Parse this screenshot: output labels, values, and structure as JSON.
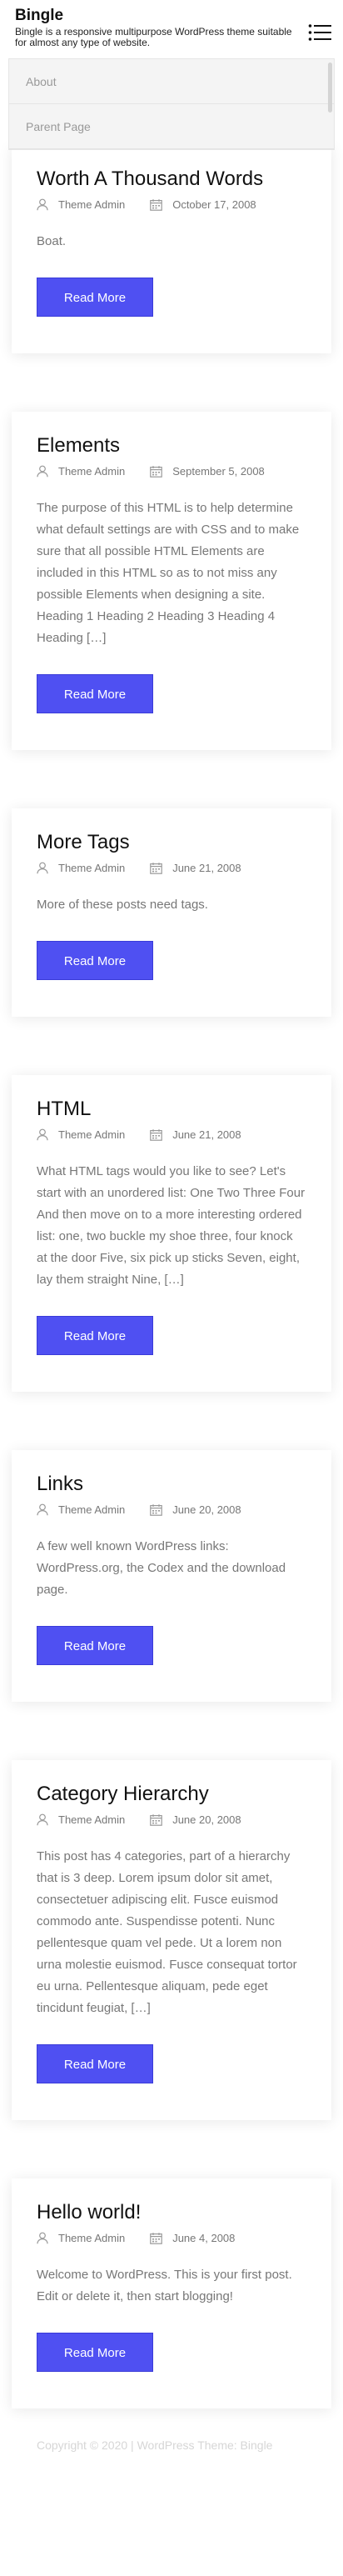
{
  "site": {
    "title": "Bingle",
    "description": "Bingle is a responsive multipurpose WordPress theme suitable for almost any type of website."
  },
  "nav": {
    "items": [
      {
        "label": "About"
      },
      {
        "label": "Parent Page"
      }
    ]
  },
  "posts": [
    {
      "title": "Worth A Thousand Words",
      "author": "Theme Admin",
      "date": "October 17, 2008",
      "excerpt": "Boat.",
      "button": "Read More"
    },
    {
      "title": "Elements",
      "author": "Theme Admin",
      "date": "September 5, 2008",
      "excerpt": "The purpose of this HTML is to help determine what default settings are with CSS and to make sure that all possible HTML Elements are included in this HTML so as to not miss any possible Elements when designing a site. Heading 1 Heading 2 Heading 3 Heading 4 Heading […]",
      "button": "Read More"
    },
    {
      "title": "More Tags",
      "author": "Theme Admin",
      "date": "June 21, 2008",
      "excerpt": "More of these posts need tags.",
      "button": "Read More"
    },
    {
      "title": "HTML",
      "author": "Theme Admin",
      "date": "June 21, 2008",
      "excerpt": "What HTML tags would you like to see? Let's start with an unordered list: One Two Three Four And then move on to a more interesting ordered list: one, two buckle my shoe three, four knock at the door Five, six pick up sticks Seven, eight, lay them straight Nine, […]",
      "button": "Read More"
    },
    {
      "title": "Links",
      "author": "Theme Admin",
      "date": "June 20, 2008",
      "excerpt": "A few well known WordPress links: WordPress.org, the Codex and the download page.",
      "button": "Read More"
    },
    {
      "title": "Category Hierarchy",
      "author": "Theme Admin",
      "date": "June 20, 2008",
      "excerpt": "This post has 4 categories, part of a hierarchy that is 3 deep. Lorem ipsum dolor sit amet, consectetuer adipiscing elit. Fusce euismod commodo ante. Suspendisse potenti. Nunc pellentesque quam vel pede. Ut a lorem non urna molestie euismod. Fusce consequat tortor eu urna. Pellentesque aliquam, pede eget tincidunt feugiat, […]",
      "button": "Read More"
    },
    {
      "title": "Hello world!",
      "author": "Theme Admin",
      "date": "June 4, 2008",
      "excerpt": "Welcome to WordPress. This is your first post. Edit or delete it, then start blogging!",
      "button": "Read More"
    }
  ],
  "footer": {
    "text": "Copyright © 2020 | WordPress Theme: Bingle"
  },
  "icons": {
    "menu": "menu-icon",
    "author": "user-icon",
    "date": "calendar-icon"
  },
  "colors": {
    "accent": "#4f50f2",
    "meta": "#777777"
  }
}
